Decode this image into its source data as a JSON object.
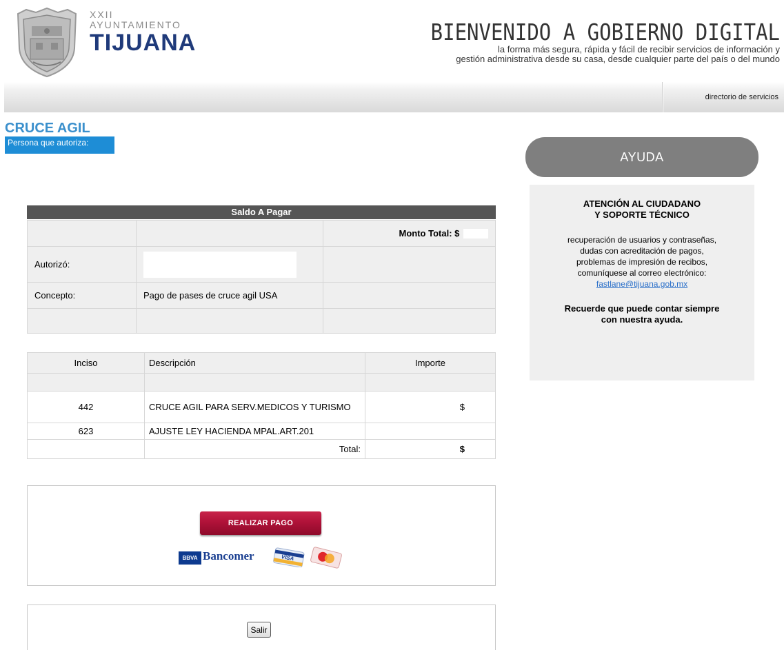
{
  "header": {
    "logo_xxii": "XXII",
    "logo_ayuntamiento": "AYUNTAMIENTO",
    "logo_city": "TIJUANA",
    "welcome_title": "BIENVENIDO A GOBIERNO DIGITAL",
    "welcome_sub_line1": "la forma más segura, rápida y fácil de recibir servicios de información y",
    "welcome_sub_line2": "gestión administrativa desde su casa, desde cualquier parte del país o del mundo"
  },
  "nav": {
    "directory_link": "directorio de servicios"
  },
  "page": {
    "title": "CRUCE AGIL",
    "persona_label": "Persona que autoriza:"
  },
  "saldo": {
    "header": "Saldo A Pagar",
    "monto_total_label": "Monto Total: $",
    "autorizo_label": "Autorizó:",
    "concepto_label": "Concepto:",
    "concepto_value": "Pago de pases de cruce agil USA"
  },
  "conceptos": {
    "headers": [
      "Inciso",
      "Descripción",
      "Importe"
    ],
    "rows": [
      {
        "inciso": "442",
        "descripcion": "CRUCE AGIL PARA SERV.MEDICOS Y TURISMO",
        "importe_prefix": "$"
      },
      {
        "inciso": "623",
        "descripcion": "AJUSTE LEY HACIENDA MPAL.ART.201",
        "importe_prefix": ""
      }
    ],
    "total_label": "Total:",
    "total_prefix": "$"
  },
  "payment": {
    "button_label": "REALIZAR PAGO",
    "bank_badge": "BBVA",
    "bank_name": "Bancomer",
    "card_visa": "VISA"
  },
  "exit": {
    "button_label": "Salir"
  },
  "help": {
    "button_label": "AYUDA",
    "title": "ATENCIÓN AL CIUDADANO\nY SOPORTE TÉCNICO",
    "text": "recuperación de usuarios y contraseñas,\ndudas con acreditación de pagos,\nproblemas de impresión de recibos,\ncomuníquese al correo electrónico:",
    "email": "fastlane@tijuana.gob.mx",
    "note": "Recuerde que puede contar siempre\ncon nuestra ayuda."
  },
  "colors": {
    "accent_blue": "#1e8dd6",
    "title_blue": "#3a8fcc",
    "logo_navy": "#1f3a7a",
    "pay_red": "#b01239",
    "help_gray": "#7f7f7f"
  }
}
